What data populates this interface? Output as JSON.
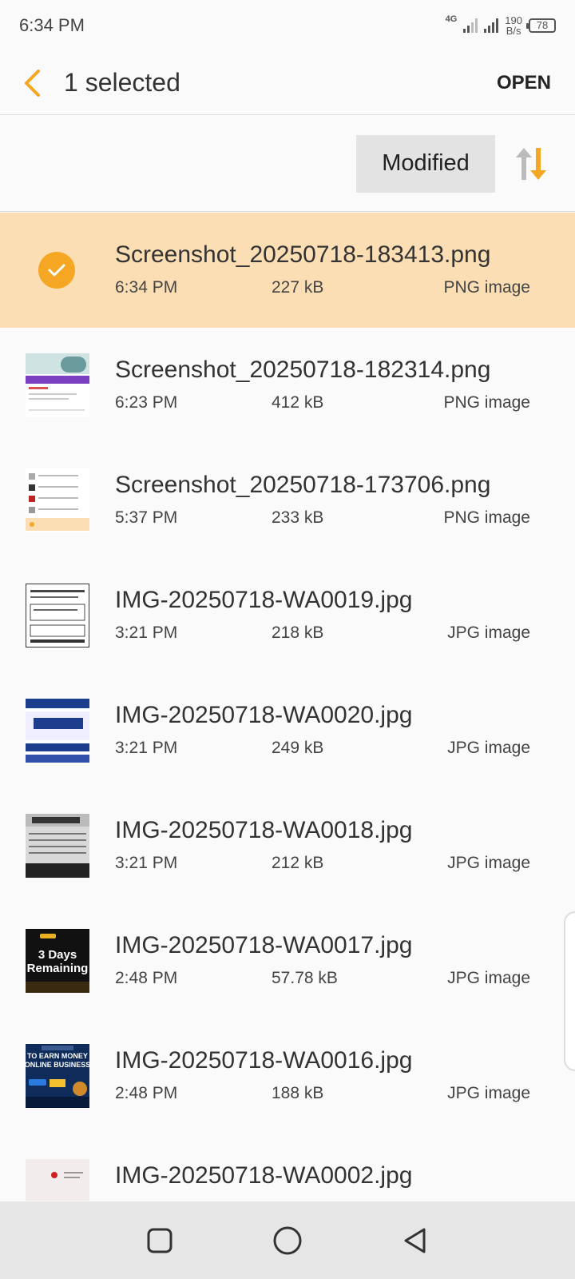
{
  "status_bar": {
    "time": "6:34 PM",
    "network_type": "4G",
    "speed_value": "190",
    "speed_unit": "B/s",
    "battery": "78"
  },
  "app_bar": {
    "back_icon": "chevron-left-icon",
    "title": "1 selected",
    "open_label": "OPEN"
  },
  "sort": {
    "label": "Modified",
    "order_icon": "sort-order-icon"
  },
  "colors": {
    "accent": "#f5a623",
    "selected_row": "#fcdeb5"
  },
  "files": [
    {
      "name": "Screenshot_20250718-183413.png",
      "time": "6:34 PM",
      "size": "227 kB",
      "type": "PNG image",
      "selected": true
    },
    {
      "name": "Screenshot_20250718-182314.png",
      "time": "6:23 PM",
      "size": "412 kB",
      "type": "PNG image",
      "selected": false
    },
    {
      "name": "Screenshot_20250718-173706.png",
      "time": "5:37 PM",
      "size": "233 kB",
      "type": "PNG image",
      "selected": false
    },
    {
      "name": "IMG-20250718-WA0019.jpg",
      "time": "3:21 PM",
      "size": "218 kB",
      "type": "JPG image",
      "selected": false
    },
    {
      "name": "IMG-20250718-WA0020.jpg",
      "time": "3:21 PM",
      "size": "249 kB",
      "type": "JPG image",
      "selected": false
    },
    {
      "name": "IMG-20250718-WA0018.jpg",
      "time": "3:21 PM",
      "size": "212 kB",
      "type": "JPG image",
      "selected": false
    },
    {
      "name": "IMG-20250718-WA0017.jpg",
      "time": "2:48 PM",
      "size": "57.78 kB",
      "type": "JPG image",
      "selected": false,
      "thumb_text": "3 Days Remaining"
    },
    {
      "name": "IMG-20250718-WA0016.jpg",
      "time": "2:48 PM",
      "size": "188 kB",
      "type": "JPG image",
      "selected": false,
      "thumb_text": "TO EARN MONEY ONLINE BUSINESS"
    },
    {
      "name": "IMG-20250718-WA0002.jpg",
      "time": "",
      "size": "",
      "type": "",
      "selected": false
    }
  ],
  "nav_bar": {
    "recents_icon": "square-icon",
    "home_icon": "circle-icon",
    "back_icon": "triangle-back-icon"
  }
}
